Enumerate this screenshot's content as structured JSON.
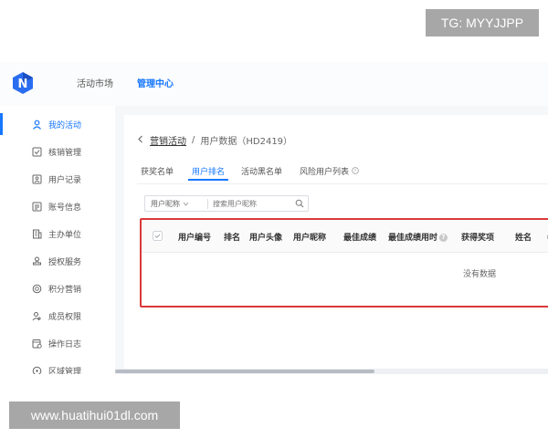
{
  "watermarks": {
    "top": "TG: MYYJJPP",
    "bottom": "www.huatihui01dl.com"
  },
  "header": {
    "nav": [
      {
        "label": "活动市场",
        "active": false
      },
      {
        "label": "管理中心",
        "active": true
      }
    ]
  },
  "sidebar": {
    "items": [
      {
        "label": "我的活动",
        "icon": "user-icon",
        "active": true
      },
      {
        "label": "核销管理",
        "icon": "check-square-icon"
      },
      {
        "label": "用户记录",
        "icon": "id-card-icon"
      },
      {
        "label": "账号信息",
        "icon": "account-card-icon"
      },
      {
        "label": "主办单位",
        "icon": "building-icon"
      },
      {
        "label": "授权服务",
        "icon": "stamp-icon"
      },
      {
        "label": "积分营销",
        "icon": "points-icon"
      },
      {
        "label": "成员权限",
        "icon": "members-icon"
      },
      {
        "label": "操作日志",
        "icon": "log-icon"
      },
      {
        "label": "区域管理",
        "icon": "region-icon"
      }
    ]
  },
  "breadcrumb": {
    "back": "营销活动",
    "separator": "/",
    "current": "用户数据（HD2419）"
  },
  "tabs": [
    {
      "label": "获奖名单"
    },
    {
      "label": "用户排名",
      "active": true
    },
    {
      "label": "活动黑名单"
    },
    {
      "label": "风险用户列表",
      "help_icon": "question-circle-icon"
    }
  ],
  "filter": {
    "field": "用户昵称",
    "placeholder": "搜索用户昵称"
  },
  "table": {
    "columns": [
      "用户编号",
      "排名",
      "用户头像",
      "用户昵称",
      "最佳成绩",
      "最佳成绩用时",
      "获得奖项",
      "姓名",
      "参与"
    ],
    "empty_text": "没有数据"
  },
  "colors": {
    "accent": "#1677ff",
    "highlight_border": "#d9393a"
  }
}
